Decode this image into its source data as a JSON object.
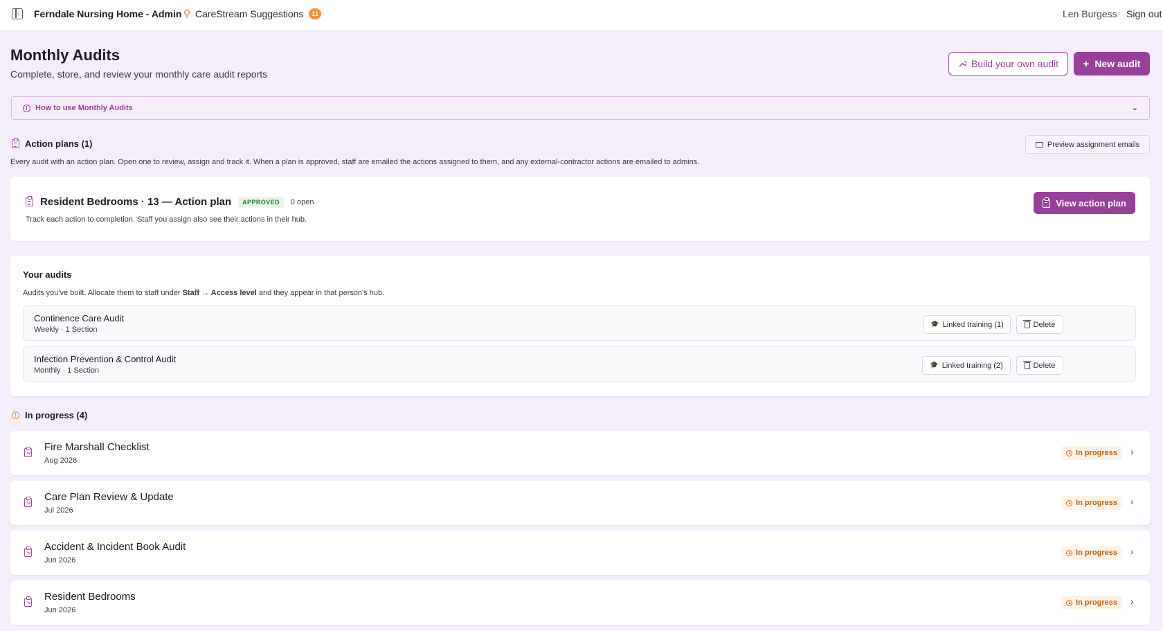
{
  "topbar": {
    "org_name": "Ferndale Nursing Home - Admin",
    "suggestions_label": "CareStream Suggestions",
    "suggestions_count": "11",
    "user_name": "Len Burgess",
    "signout_label": "Sign out"
  },
  "page": {
    "title": "Monthly Audits",
    "subtitle": "Complete, store, and review your monthly care audit reports",
    "build_button": "Build your own audit",
    "new_button": "New audit",
    "howto_label": "How to use Monthly Audits"
  },
  "action_plans": {
    "heading": "Action plans (1)",
    "preview_button": "Preview assignment emails",
    "description": "Every audit with an action plan. Open one to review, assign and track it. When a plan is approved, staff are emailed the actions assigned to them, and any external-contractor actions are emailed to admins.",
    "plan": {
      "title": "Resident Bedrooms · 13 — Action plan",
      "status": "APPROVED",
      "open_count": "0 open",
      "description": "Track each action to completion. Staff you assign also see their actions in their hub.",
      "view_button": "View action plan"
    }
  },
  "your_audits": {
    "heading": "Your audits",
    "desc_prefix": "Audits you've built. Allocate them to staff under ",
    "desc_strong1": "Staff",
    "desc_arrow": " → ",
    "desc_strong2": "Access level",
    "desc_suffix": " and they appear in that person's hub.",
    "items": [
      {
        "name": "Continence Care Audit",
        "meta": "Weekly · 1 Section",
        "training": "Linked training (1)",
        "delete": "Delete"
      },
      {
        "name": "Infection Prevention & Control Audit",
        "meta": "Monthly · 1 Section",
        "training": "Linked training (2)",
        "delete": "Delete"
      }
    ]
  },
  "in_progress": {
    "heading": "In progress (4)",
    "status_label": "In progress",
    "items": [
      {
        "name": "Fire Marshall Checklist",
        "date": "Aug 2026"
      },
      {
        "name": "Care Plan Review & Update",
        "date": "Jul 2026"
      },
      {
        "name": "Accident & Incident Book Audit",
        "date": "Jun 2026"
      },
      {
        "name": "Resident Bedrooms",
        "date": "Jun 2026"
      }
    ]
  },
  "colors": {
    "accent": "#973f99",
    "background": "#f3eefa",
    "approved": "#1e7a3a",
    "in_progress": "#b86219"
  }
}
